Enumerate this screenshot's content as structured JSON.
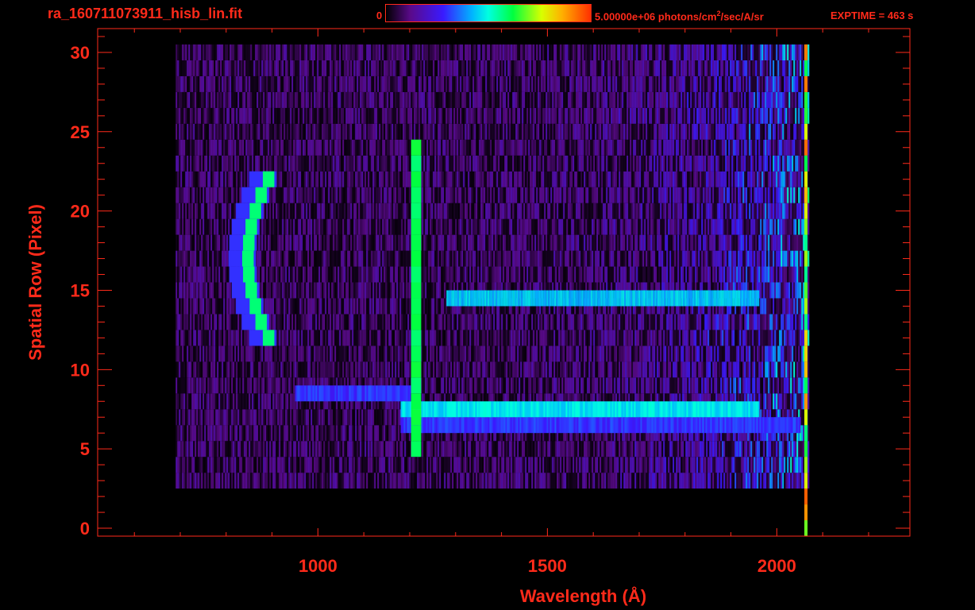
{
  "header": {
    "filename": "ra_160711073911_hisb_lin.fit",
    "colorbar_min": "0",
    "colorbar_max": "5.00000e+06 photons/cm",
    "colorbar_max_sup": "2",
    "colorbar_max_suffix": "/sec/A/sr",
    "exptime": "EXPTIME = 463 s"
  },
  "colors": {
    "axis": "#ff2a1a",
    "background": "#000000"
  },
  "chart_data": {
    "type": "heatmap",
    "title": "ra_160711073911_hisb_lin.fit",
    "xlabel": "Wavelength (Å)",
    "ylabel": "Spatial Row (Pixel)",
    "xlim": [
      520,
      2290
    ],
    "ylim": [
      -0.5,
      31.5
    ],
    "x_ticks": [
      1000,
      1500,
      2000
    ],
    "y_ticks": [
      0,
      5,
      10,
      15,
      20,
      25,
      30
    ],
    "colorbar": {
      "min": 0,
      "max": 5000000,
      "units": "photons/cm^2/sec/A/sr",
      "colormap": "rainbow"
    },
    "grid": false,
    "noise_region": {
      "x_range": [
        690,
        2070
      ],
      "row_range": [
        3,
        30
      ]
    },
    "features": [
      {
        "name": "arc",
        "x_range": [
          820,
          900
        ],
        "row_range": [
          12,
          22
        ],
        "peak_rows": [
          15,
          19
        ]
      },
      {
        "name": "vertical line",
        "x": 1215,
        "row_range": [
          5,
          24
        ]
      },
      {
        "name": "horizontal band",
        "row": 7,
        "x_range": [
          1180,
          2050
        ]
      },
      {
        "name": "horizontal band",
        "row": 14.5,
        "x_range": [
          1280,
          1960
        ]
      },
      {
        "name": "horizontal band (faint)",
        "row": 8.5,
        "x_range": [
          950,
          1200
        ]
      }
    ]
  }
}
